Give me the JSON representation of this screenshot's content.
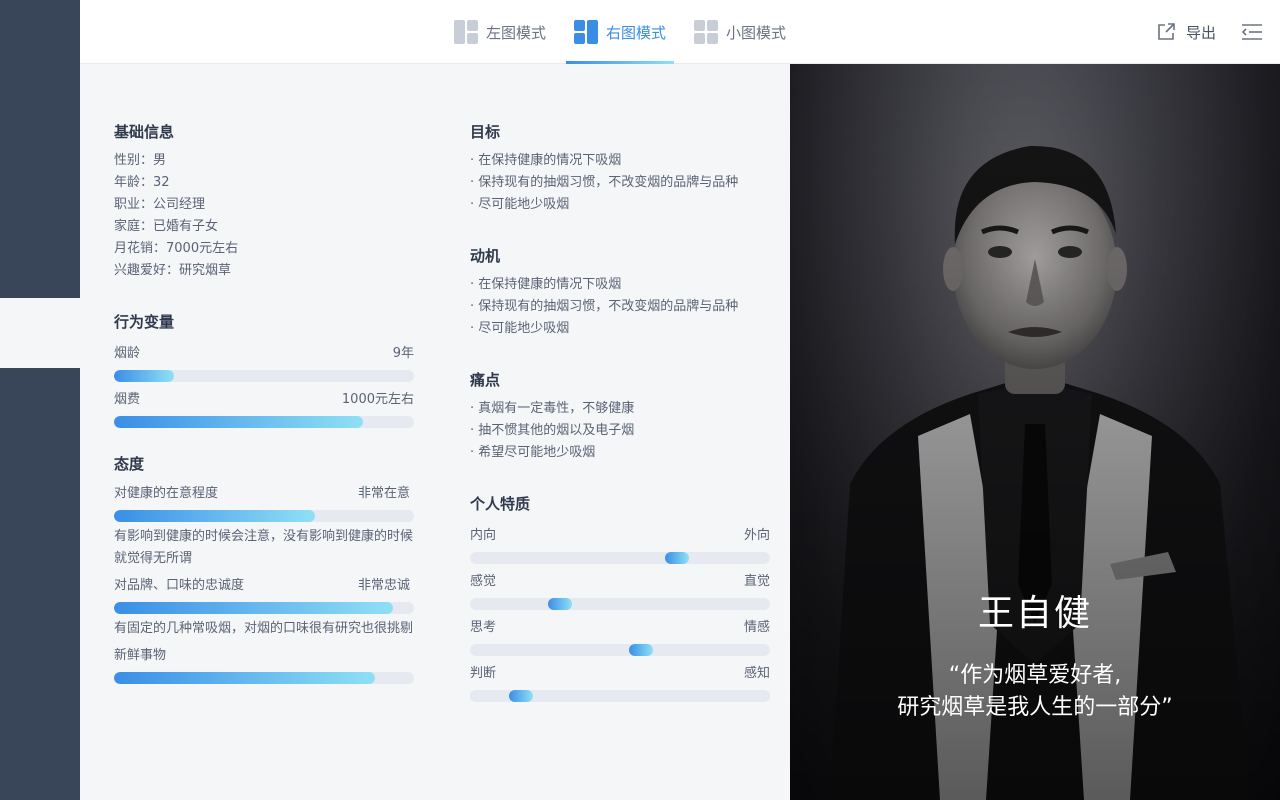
{
  "toolbar": {
    "tabs": [
      {
        "label": "左图模式",
        "icon": "layout-left-icon",
        "active": false
      },
      {
        "label": "右图模式",
        "icon": "layout-right-icon",
        "active": true
      },
      {
        "label": "小图模式",
        "icon": "layout-grid-icon",
        "active": false
      }
    ],
    "export_label": "导出",
    "accent": "#3a8ee6"
  },
  "basic": {
    "title": "基础信息",
    "lines": [
      "性别：男",
      "年龄：32",
      "职业：公司经理",
      "家庭：已婚有子女",
      "月花销：7000元左右",
      "兴趣爱好：研究烟草"
    ]
  },
  "behavior": {
    "title": "行为变量",
    "items": [
      {
        "label": "烟龄",
        "value": "9年",
        "fill": 0.2
      },
      {
        "label": "烟费",
        "value": "1000元左右",
        "fill": 0.83
      }
    ]
  },
  "attitude": {
    "title": "态度",
    "items": [
      {
        "label": "对健康的在意程度",
        "value": "非常在意",
        "fill": 0.67,
        "desc": "有影响到健康的时候会注意，没有影响到健康的时候就觉得无所谓"
      },
      {
        "label": "对品牌、口味的忠诚度",
        "value": "非常忠诚",
        "fill": 0.93,
        "desc": "有固定的几种常吸烟，对烟的口味很有研究也很挑剔"
      },
      {
        "label": "新鲜事物",
        "value": "",
        "fill": 0.87,
        "desc": ""
      }
    ]
  },
  "goals": {
    "title": "目标",
    "items": [
      "· 在保持健康的情况下吸烟",
      "· 保持现有的抽烟习惯，不改变烟的品牌与品种",
      "· 尽可能地少吸烟"
    ]
  },
  "motives": {
    "title": "动机",
    "items": [
      "· 在保持健康的情况下吸烟",
      "· 保持现有的抽烟习惯，不改变烟的品牌与品种",
      "· 尽可能地少吸烟"
    ]
  },
  "pains": {
    "title": "痛点",
    "items": [
      "· 真烟有一定毒性，不够健康",
      "· 抽不惯其他的烟以及电子烟",
      "· 希望尽可能地少吸烟"
    ]
  },
  "traits": {
    "title": "个人特质",
    "items": [
      {
        "left": "内向",
        "right": "外向",
        "pos": 0.69
      },
      {
        "left": "感觉",
        "right": "直觉",
        "pos": 0.3
      },
      {
        "left": "思考",
        "right": "情感",
        "pos": 0.57
      },
      {
        "left": "判断",
        "right": "感知",
        "pos": 0.17
      }
    ]
  },
  "persona": {
    "name": "王自健",
    "quote_line1": "“作为烟草爱好者,",
    "quote_line2": "研究烟草是我人生的一部分”"
  }
}
